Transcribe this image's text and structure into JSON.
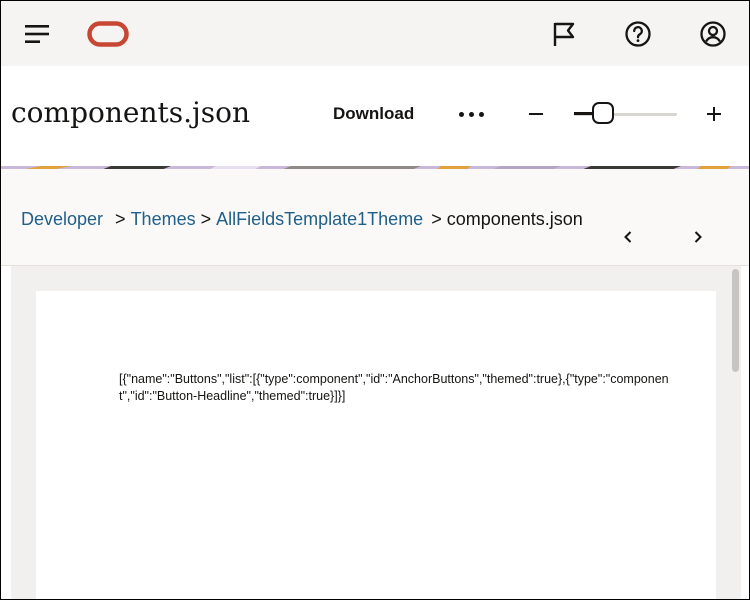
{
  "header": {
    "menu_icon": "hamburger-menu-icon",
    "logo_icon": "oracle-logo",
    "flag_icon": "flag-icon",
    "help_icon": "help-circle-icon",
    "user_icon": "user-avatar-icon",
    "logo_color": "#c74634"
  },
  "toolbar": {
    "title": "components.json",
    "download_label": "Download",
    "more_icon": "more-options-icon",
    "zoom_out_icon": "minus-icon",
    "zoom_in_icon": "plus-icon",
    "zoom_level_fraction": 0.28
  },
  "breadcrumb": {
    "items": [
      "Developer",
      "Themes",
      "AllFieldsTemplate1Theme"
    ],
    "separator": ">",
    "current": "components.json",
    "prev_icon": "chevron-left-icon",
    "next_icon": "chevron-right-icon"
  },
  "document": {
    "content": "[{\"name\":\"Buttons\",\"list\":[{\"type\":component\",\"id\":\"AnchorButtons\",\"themed\":true},{\"type\":\"component\",\"id\":\"Button-Headline\",\"themed\":true}]}]"
  },
  "colors": {
    "topbar_bg": "#f5f4f2",
    "link": "#1f5f88",
    "viewer_bg": "#f1f0ee"
  }
}
